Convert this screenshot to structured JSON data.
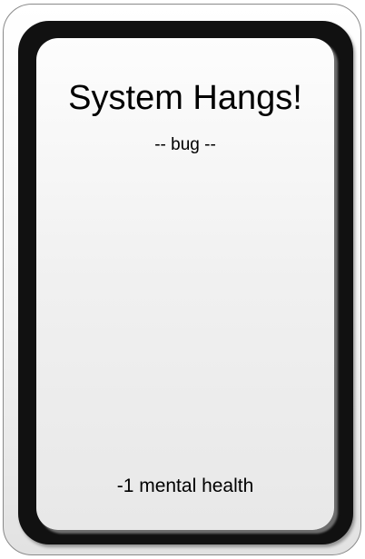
{
  "card": {
    "title": "System Hangs!",
    "type_line": "-- bug --",
    "effect": "-1 mental health"
  },
  "colors": {
    "frame": "#111111",
    "face": "#f0f0f0",
    "outer_border": "#8a8a8a",
    "text": "#000000"
  }
}
